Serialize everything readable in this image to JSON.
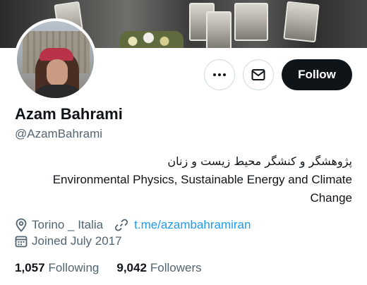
{
  "profile": {
    "name": "Azam Bahrami",
    "handle": "@AzamBahrami",
    "bio_fa": "پژوهشگر و کنشگر محیط زیست و زنان",
    "bio_en_line1": "Environmental Physics, Sustainable Energy and Climate",
    "bio_en_line2": "Change",
    "location": "Torino _ Italia",
    "website": "t.me/azambahramiran",
    "joined": "Joined July 2017"
  },
  "actions": {
    "more_icon": "more-horizontal-icon",
    "message_icon": "mail-icon",
    "follow_label": "Follow"
  },
  "stats": {
    "following_count": "1,057",
    "following_label": "Following",
    "followers_count": "9,042",
    "followers_label": "Followers"
  },
  "colors": {
    "text": "#0f1419",
    "secondary": "#536471",
    "link": "#1d9bf0",
    "follow_bg": "#0f1419"
  }
}
